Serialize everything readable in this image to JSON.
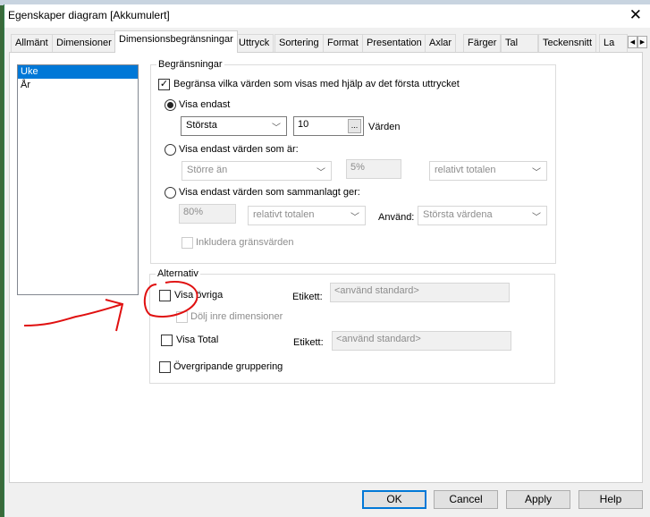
{
  "window": {
    "title": "Egenskaper diagram [Akkumulert]",
    "close_icon": "close-icon"
  },
  "tabs": [
    "Allmänt",
    "Dimensioner",
    "Dimensionsbegränsningar",
    "Uttryck",
    "Sortering",
    "Format",
    "Presentation",
    "Axlar",
    "Färger",
    "Tal",
    "Teckensnitt",
    "La"
  ],
  "active_tab": "Dimensionsbegränsningar",
  "dimensions": [
    "Uke",
    "År"
  ],
  "limits": {
    "legend": "Begränsningar",
    "restrict_label": "Begränsa vilka värden som visas med hjälp av det första uttrycket",
    "restrict_checked": true,
    "show_only_label": "Visa endast",
    "show_only_mode": "Största",
    "show_only_count": "10",
    "ellipsis": "...",
    "values_label": "Värden",
    "show_only_values_label": "Visa endast värden som är:",
    "comparison": "Större än",
    "percent1": "5%",
    "relative1": "relativt totalen",
    "accumulate_label": "Visa endast värden som sammanlagt ger:",
    "percent2": "80%",
    "relative2": "relativt totalen",
    "use_label": "Använd:",
    "use_value": "Största värdena",
    "include_limits_label": "Inkludera gränsvärden"
  },
  "options": {
    "legend": "Alternativ",
    "show_others_label": "Visa övriga",
    "label1": "Etikett:",
    "label1_placeholder": "<använd standard>",
    "hide_inner_label": "Dölj inre dimensioner",
    "show_total_label": "Visa Total",
    "label2": "Etikett:",
    "label2_placeholder": "<använd standard>",
    "global_grouping_label": "Övergripande gruppering"
  },
  "buttons": {
    "ok": "OK",
    "cancel": "Cancel",
    "apply": "Apply",
    "help": "Help"
  },
  "annotation_color": "#e01010"
}
